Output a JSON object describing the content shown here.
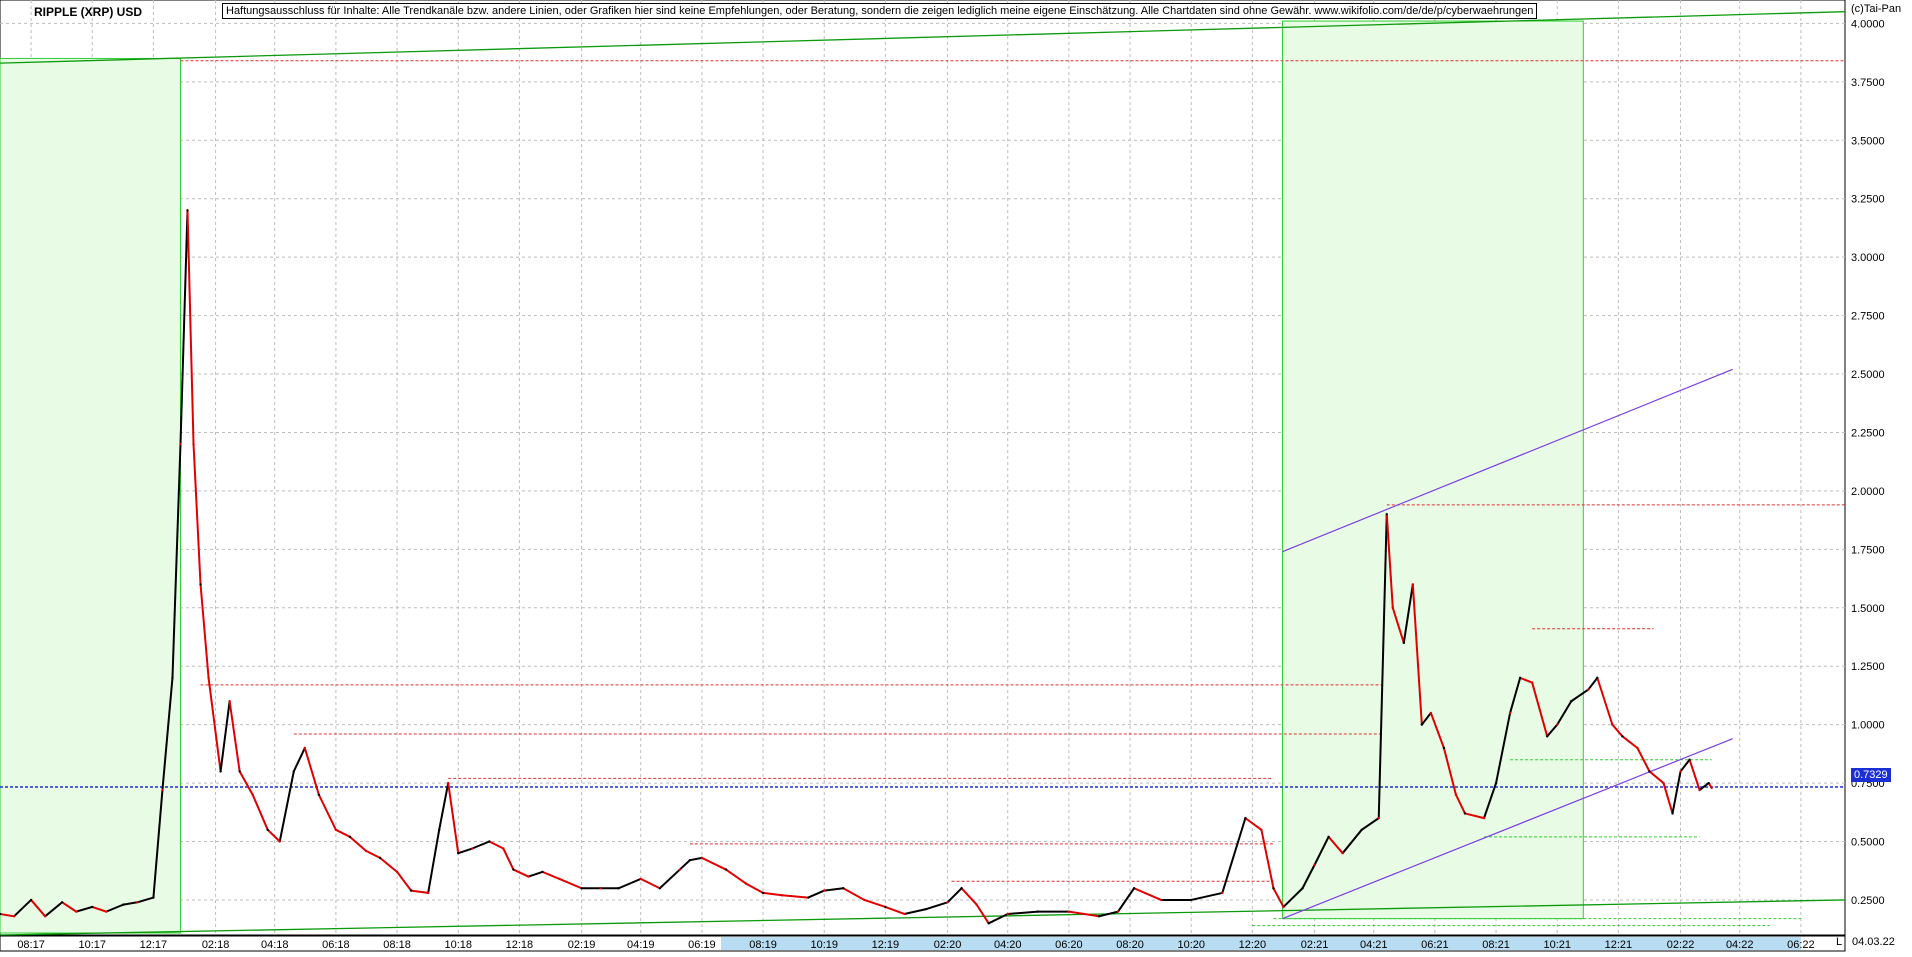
{
  "header": {
    "title": "RIPPLE (XRP) USD",
    "disclaimer": "Haftungsausschluss für Inhalte: Alle Trendkanäle bzw. andere Linien, oder Grafiken hier sind keine Empfehlungen, oder Beratung, sondern die zeigen lediglich meine eigene Einschätzung. Alle Chartdaten sind ohne Gewähr.  www.wikifolio.com/de/de/p/cyberwaehrungen",
    "copyright": "(c)Tai-Pan"
  },
  "footer": {
    "last_date": "04.03.22",
    "mode_label": "L"
  },
  "colors": {
    "candle_up": "#000000",
    "candle_down": "#e00000",
    "green_zone_fill": "#e8fbe4",
    "green_zone_line": "#33cc33",
    "trend_green": "#0a9a0a",
    "channel_purple": "#7b3fe4",
    "level_red": "#e03030",
    "level_green": "#33cc33",
    "price_line": "#1a2fd6",
    "grid": "#bdbdbd"
  },
  "chart_data": {
    "type": "line",
    "title": "RIPPLE (XRP) USD",
    "xlabel": "",
    "ylabel": "",
    "x_range": [
      "2017-07-01",
      "2022-07-15"
    ],
    "ylim": [
      0.1,
      4.1
    ],
    "grid": true,
    "y_ticks": [
      "0.2500",
      "0.5000",
      "0.7500",
      "1.0000",
      "1.2500",
      "1.5000",
      "1.7500",
      "2.0000",
      "2.2500",
      "2.5000",
      "2.7500",
      "3.0000",
      "3.2500",
      "3.5000",
      "3.7500",
      "4.0000"
    ],
    "x_ticks": [
      "08:17",
      "10:17",
      "12:17",
      "02:18",
      "04:18",
      "06:18",
      "08:18",
      "10:18",
      "12:18",
      "02:19",
      "04:19",
      "06:19",
      "08:19",
      "10:19",
      "12:19",
      "02:20",
      "04:20",
      "06:20",
      "08:20",
      "10:20",
      "12:20",
      "02:21",
      "04:21",
      "06:21",
      "08:21",
      "10:21",
      "12:21",
      "02:22",
      "04:22",
      "06:22"
    ],
    "last_price": 0.7329,
    "last_price_label": "0.7329",
    "series": [
      {
        "x": [
          "2017-07-01",
          "2017-07-15",
          "2017-08-01",
          "2017-08-15",
          "2017-09-01",
          "2017-09-15",
          "2017-10-01",
          "2017-10-15",
          "2017-11-01",
          "2017-11-15",
          "2017-12-01",
          "2017-12-10",
          "2017-12-20",
          "2017-12-28",
          "2018-01-04",
          "2018-01-10",
          "2018-01-17",
          "2018-01-25",
          "2018-02-06",
          "2018-02-15",
          "2018-02-25",
          "2018-03-10",
          "2018-03-25",
          "2018-04-06",
          "2018-04-20",
          "2018-05-01",
          "2018-05-15",
          "2018-06-01",
          "2018-06-15",
          "2018-07-01",
          "2018-07-15",
          "2018-08-01",
          "2018-08-15",
          "2018-09-01",
          "2018-09-12",
          "2018-09-21",
          "2018-10-01",
          "2018-10-15",
          "2018-11-01",
          "2018-11-15",
          "2018-11-25",
          "2018-12-10",
          "2018-12-24",
          "2019-01-10",
          "2019-02-01",
          "2019-02-20",
          "2019-03-10",
          "2019-04-01",
          "2019-04-20",
          "2019-05-10",
          "2019-05-20",
          "2019-06-01",
          "2019-06-25",
          "2019-07-15",
          "2019-08-01",
          "2019-08-20",
          "2019-09-15",
          "2019-10-01",
          "2019-10-20",
          "2019-11-10",
          "2019-12-01",
          "2019-12-20",
          "2020-01-10",
          "2020-02-01",
          "2020-02-15",
          "2020-03-01",
          "2020-03-13",
          "2020-04-01",
          "2020-05-01",
          "2020-06-01",
          "2020-07-01",
          "2020-07-20",
          "2020-08-05",
          "2020-09-01",
          "2020-10-01",
          "2020-11-01",
          "2020-11-24",
          "2020-12-10",
          "2020-12-22",
          "2021-01-01",
          "2021-01-20",
          "2021-02-01",
          "2021-02-15",
          "2021-03-01",
          "2021-03-20",
          "2021-04-06",
          "2021-04-14",
          "2021-04-20",
          "2021-05-01",
          "2021-05-10",
          "2021-05-19",
          "2021-05-28",
          "2021-06-10",
          "2021-06-22",
          "2021-07-01",
          "2021-07-20",
          "2021-08-01",
          "2021-08-15",
          "2021-08-25",
          "2021-09-06",
          "2021-09-21",
          "2021-10-01",
          "2021-10-15",
          "2021-11-01",
          "2021-11-10",
          "2021-11-25",
          "2021-12-05",
          "2021-12-20",
          "2022-01-01",
          "2022-01-15",
          "2022-01-24",
          "2022-02-01",
          "2022-02-10",
          "2022-02-20",
          "2022-03-01",
          "2022-03-04"
        ],
        "y": [
          0.19,
          0.18,
          0.25,
          0.18,
          0.24,
          0.2,
          0.22,
          0.2,
          0.23,
          0.24,
          0.26,
          0.72,
          1.2,
          2.2,
          3.2,
          2.2,
          1.6,
          1.2,
          0.8,
          1.1,
          0.8,
          0.7,
          0.55,
          0.5,
          0.8,
          0.9,
          0.7,
          0.55,
          0.52,
          0.46,
          0.43,
          0.37,
          0.29,
          0.28,
          0.55,
          0.75,
          0.45,
          0.47,
          0.5,
          0.47,
          0.38,
          0.35,
          0.37,
          0.34,
          0.3,
          0.3,
          0.3,
          0.34,
          0.3,
          0.38,
          0.42,
          0.43,
          0.38,
          0.32,
          0.28,
          0.27,
          0.26,
          0.29,
          0.3,
          0.25,
          0.22,
          0.19,
          0.21,
          0.24,
          0.3,
          0.23,
          0.15,
          0.19,
          0.2,
          0.2,
          0.18,
          0.2,
          0.3,
          0.25,
          0.25,
          0.28,
          0.6,
          0.55,
          0.3,
          0.22,
          0.3,
          0.4,
          0.52,
          0.45,
          0.55,
          0.6,
          1.9,
          1.5,
          1.35,
          1.6,
          1.0,
          1.05,
          0.9,
          0.7,
          0.62,
          0.6,
          0.75,
          1.05,
          1.2,
          1.18,
          0.95,
          1.0,
          1.1,
          1.15,
          1.2,
          1.0,
          0.95,
          0.9,
          0.8,
          0.75,
          0.62,
          0.8,
          0.85,
          0.72,
          0.75,
          0.73
        ]
      }
    ]
  }
}
